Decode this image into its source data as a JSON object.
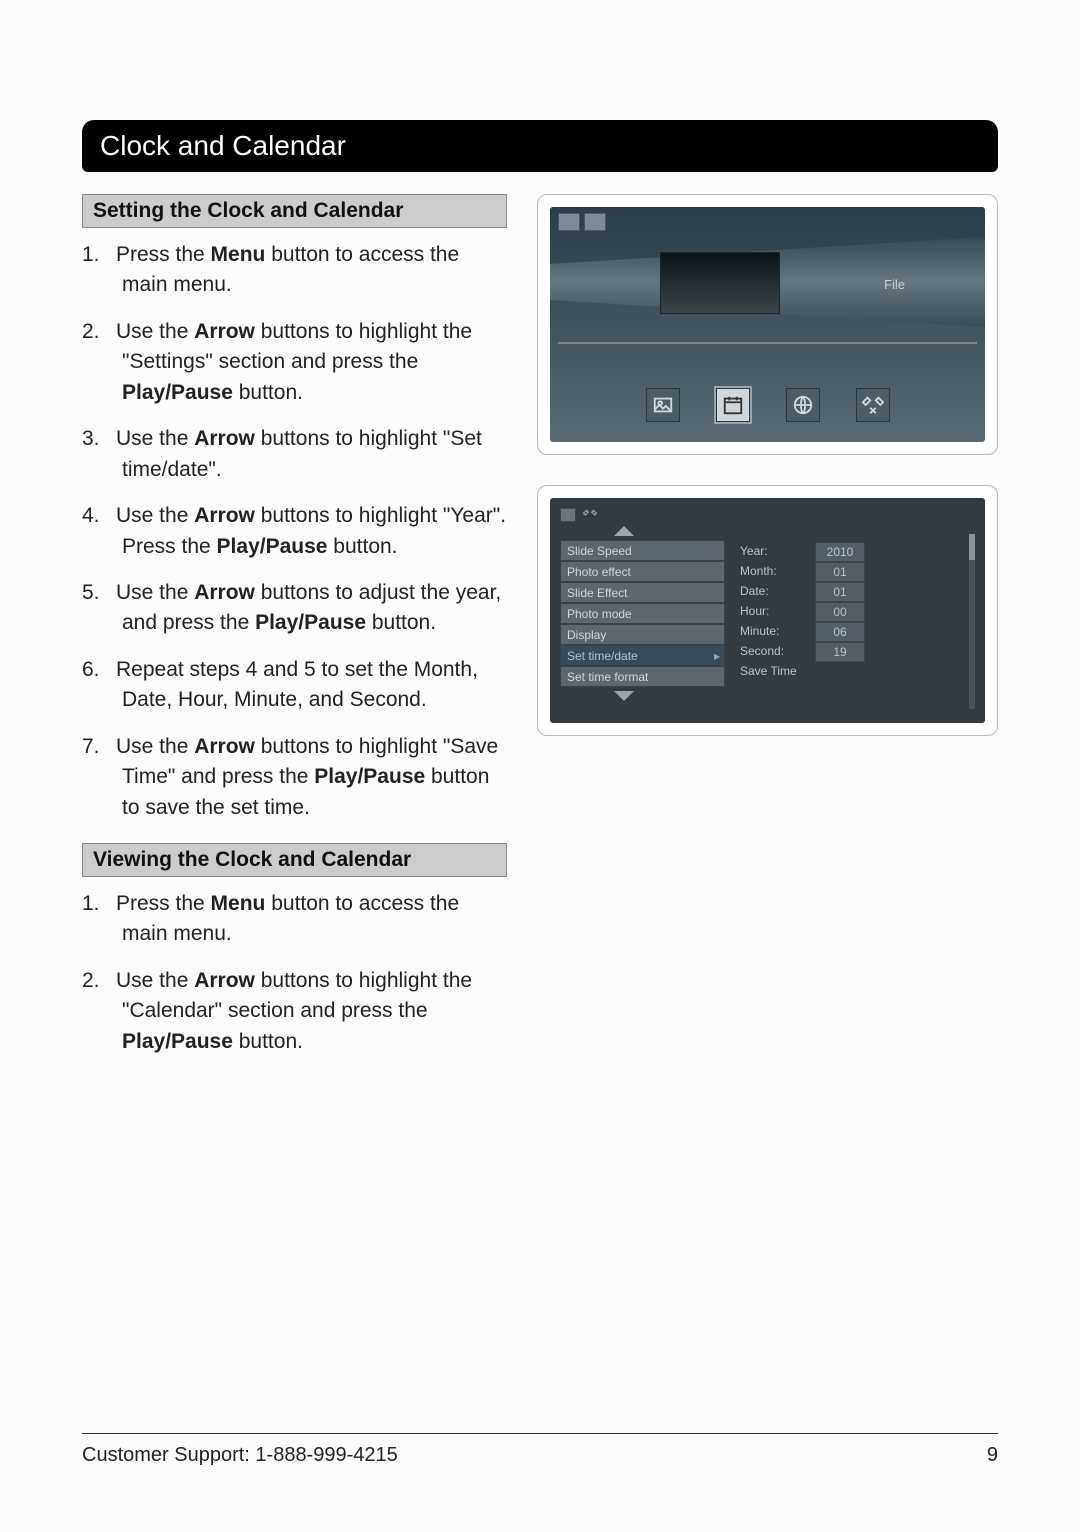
{
  "title": "Clock and Calendar",
  "sections": [
    {
      "heading": "Setting the Clock and Calendar",
      "steps": [
        "Press the <b>Menu</b> button to access the main menu.",
        "Use the <b>Arrow</b> buttons to highlight the \"Settings\" section and press the <b>Play/Pause</b> button.",
        "Use the <b>Arrow</b> buttons to highlight \"Set time/date\".",
        "Use the <b>Arrow</b> buttons to highlight \"Year\". Press the <b>Play/Pause</b> button.",
        "Use the <b>Arrow</b> buttons to adjust the year, and press the <b>Play/Pause</b> button.",
        "Repeat steps 4 and 5 to set the Month, Date, Hour, Minute, and Second.",
        "Use the <b>Arrow</b> buttons to highlight \"Save Time\" and press the <b>Play/Pause</b> button to save the set time."
      ]
    },
    {
      "heading": "Viewing the Clock and Calendar",
      "steps": [
        "Press the <b>Menu</b> button to access the main menu.",
        "Use the <b>Arrow</b> buttons to highlight the \"Calendar\" section and press the <b>Play/Pause</b> button."
      ]
    }
  ],
  "screenshot1": {
    "file_label": "File",
    "icons": [
      "photo-icon",
      "calendar-icon",
      "globe-icon",
      "tools-icon"
    ]
  },
  "screenshot2": {
    "menu": [
      "Slide Speed",
      "Photo effect",
      "Slide Effect",
      "Photo mode",
      "Display",
      "Set time/date",
      "Set time format"
    ],
    "selected_index": 5,
    "fields": [
      {
        "k": "Year:",
        "v": "2010"
      },
      {
        "k": "Month:",
        "v": "01"
      },
      {
        "k": "Date:",
        "v": "01"
      },
      {
        "k": "Hour:",
        "v": "00"
      },
      {
        "k": "Minute:",
        "v": "06"
      },
      {
        "k": "Second:",
        "v": "19"
      },
      {
        "k": "Save Time",
        "v": ""
      }
    ]
  },
  "footer": {
    "support": "Customer Support: 1-888-999-4215",
    "page": "9"
  }
}
